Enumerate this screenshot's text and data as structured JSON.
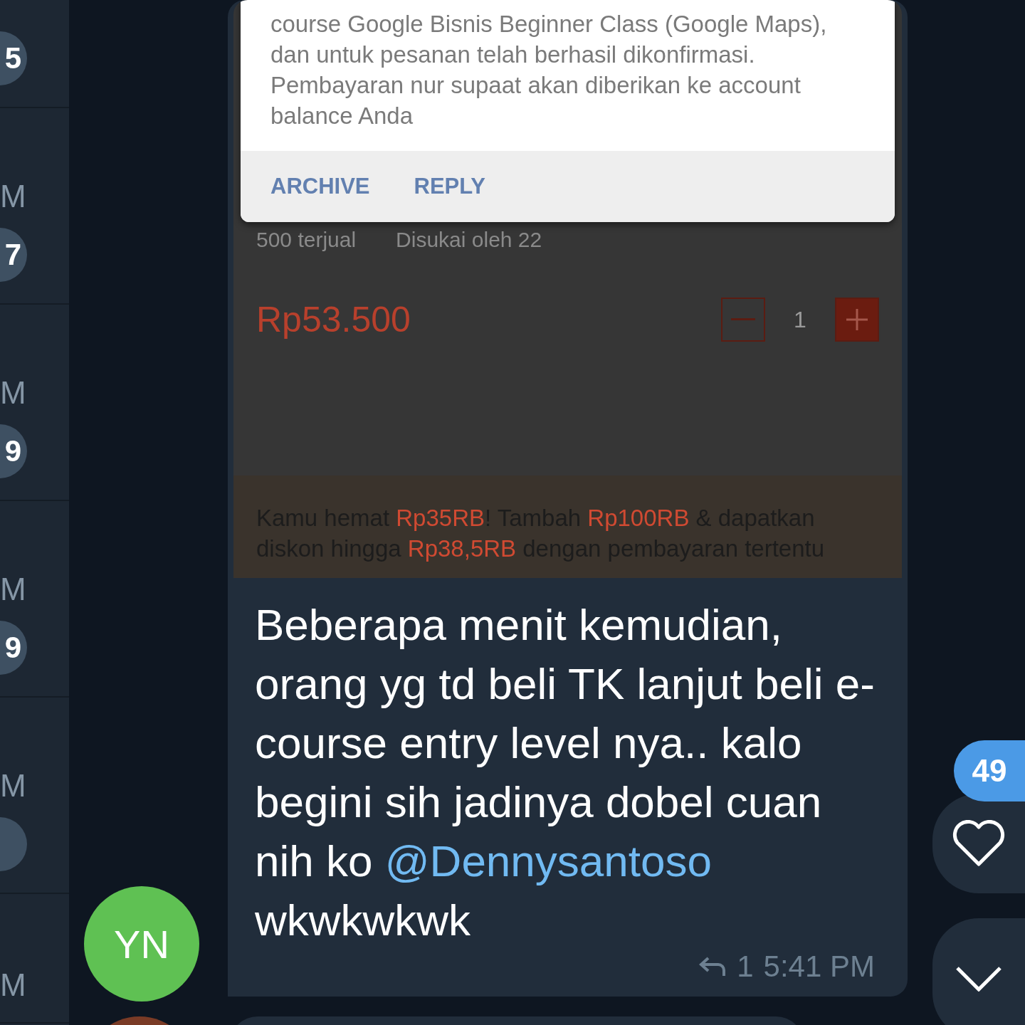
{
  "chat_list_strip": {
    "rows": [
      {
        "badge": "5"
      },
      {
        "time": "M",
        "badge": "7"
      },
      {
        "time": "M",
        "badge": "9"
      },
      {
        "time": "M",
        "badge": "9"
      },
      {
        "time": "M",
        "badge": ""
      },
      {
        "time": "M"
      }
    ]
  },
  "message": {
    "sender_initials": "YN",
    "screenshot": {
      "notification": {
        "body_lines": [
          "course Google Bisnis Beginner Class (Google Maps), dan untuk pesanan telah berhasil dikonfirmasi.",
          "Pembayaran nur supaat akan diberikan ke account balance Anda"
        ],
        "actions": [
          "ARCHIVE",
          "REPLY"
        ]
      },
      "sold": "500 terjual",
      "liked": "Disukai oleh 22",
      "price": "Rp53.500",
      "quantity": "1",
      "promo": [
        {
          "kind": "text",
          "text": "Kamu hemat "
        },
        {
          "kind": "price",
          "text": "Rp35RB"
        },
        {
          "kind": "text",
          "text": "! Tambah "
        },
        {
          "kind": "price",
          "text": "Rp100RB"
        },
        {
          "kind": "text",
          "text": " & dapatkan diskon hingga "
        },
        {
          "kind": "price",
          "text": "Rp38,5RB"
        },
        {
          "kind": "text",
          "text": " dengan pembayaran tertentu"
        }
      ]
    },
    "text": "Beberapa menit kemudian, orang yg td beli TK lanjut beli e-course entry level nya.. kalo begini sih jadinya dobel cuan nih ko ",
    "mention": "@Dennysantoso",
    "text_after": " wkwkwkwk",
    "replies": "1",
    "time": "5:41 PM"
  },
  "unread_count": "49"
}
